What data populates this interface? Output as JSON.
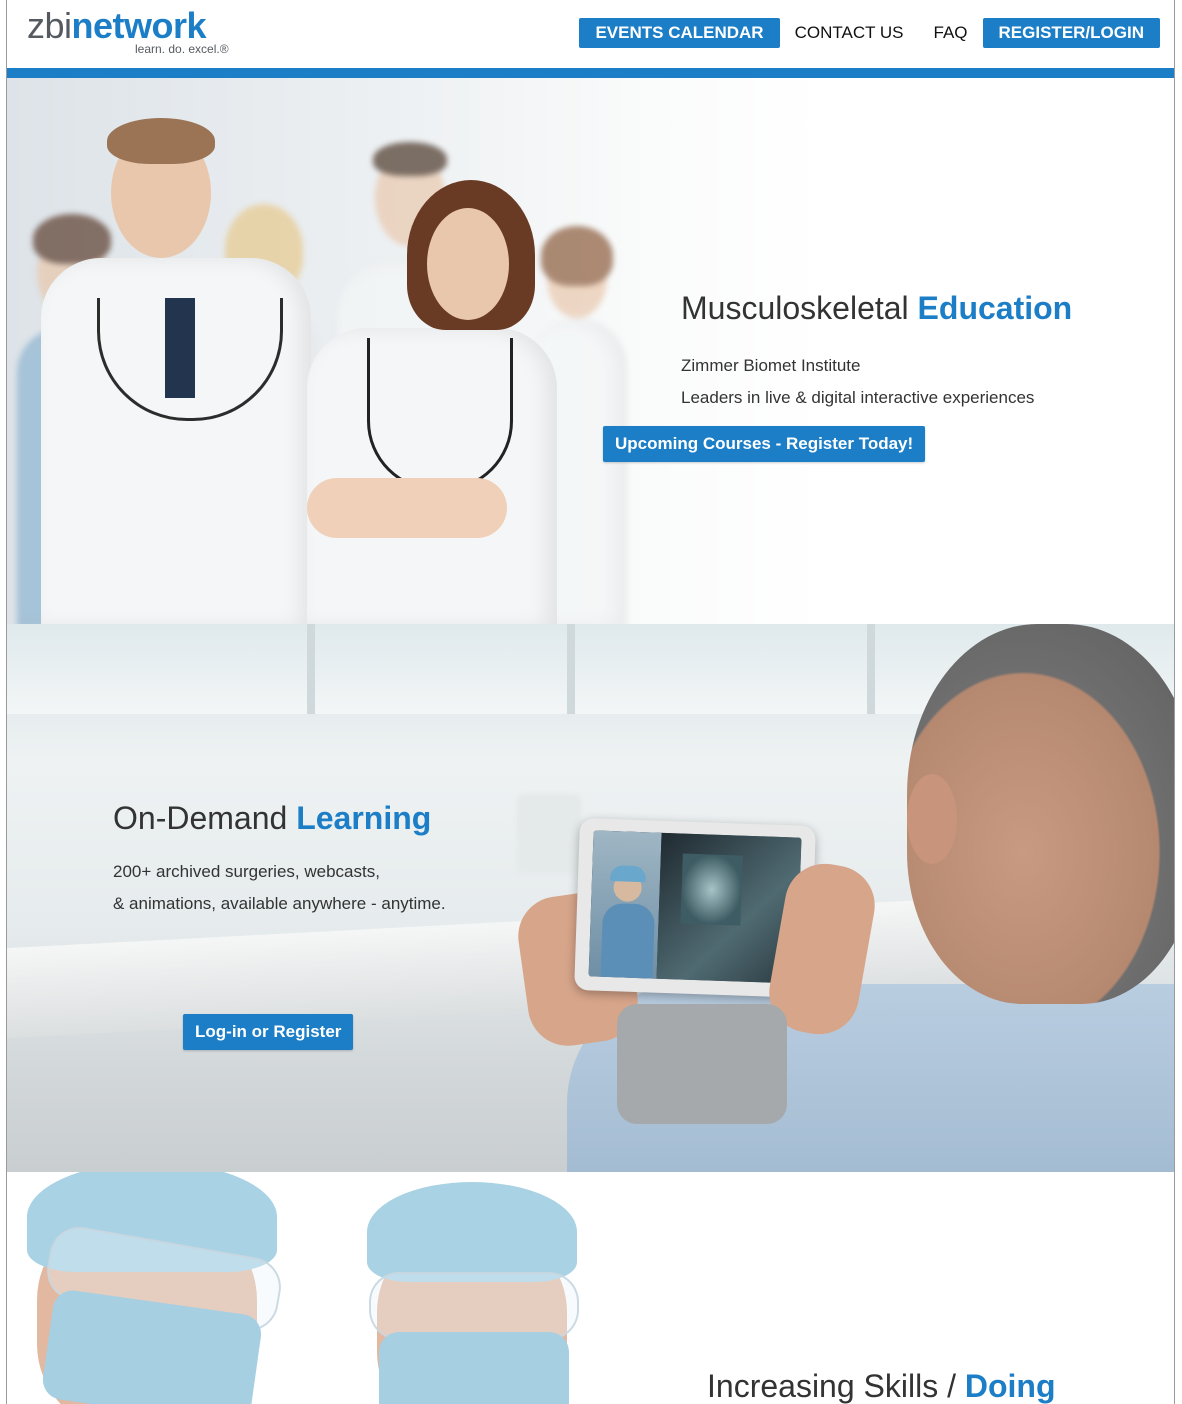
{
  "brand": {
    "name_part1": "zbi",
    "name_part2": "network",
    "tagline": "learn. do. excel.®"
  },
  "nav": {
    "events_calendar": "EVENTS CALENDAR",
    "contact_us": "CONTACT US",
    "faq": "FAQ",
    "register_login": "REGISTER/LOGIN"
  },
  "hero": {
    "title_plain": "Musculoskeletal ",
    "title_accent": "Education",
    "line1": "Zimmer Biomet Institute",
    "line2": "Leaders in live & digital interactive experiences",
    "cta": "Upcoming Courses - Register Today!"
  },
  "on_demand": {
    "title_plain": "On-Demand ",
    "title_accent": "Learning",
    "line1": "200+ archived surgeries, webcasts,",
    "line2": "& animations, available anywhere - anytime.",
    "cta": "Log-in or Register"
  },
  "skills": {
    "title_plain": "Increasing Skills / ",
    "title_accent": "Doing"
  },
  "colors": {
    "accent": "#1c7ec6",
    "text": "#333333"
  }
}
